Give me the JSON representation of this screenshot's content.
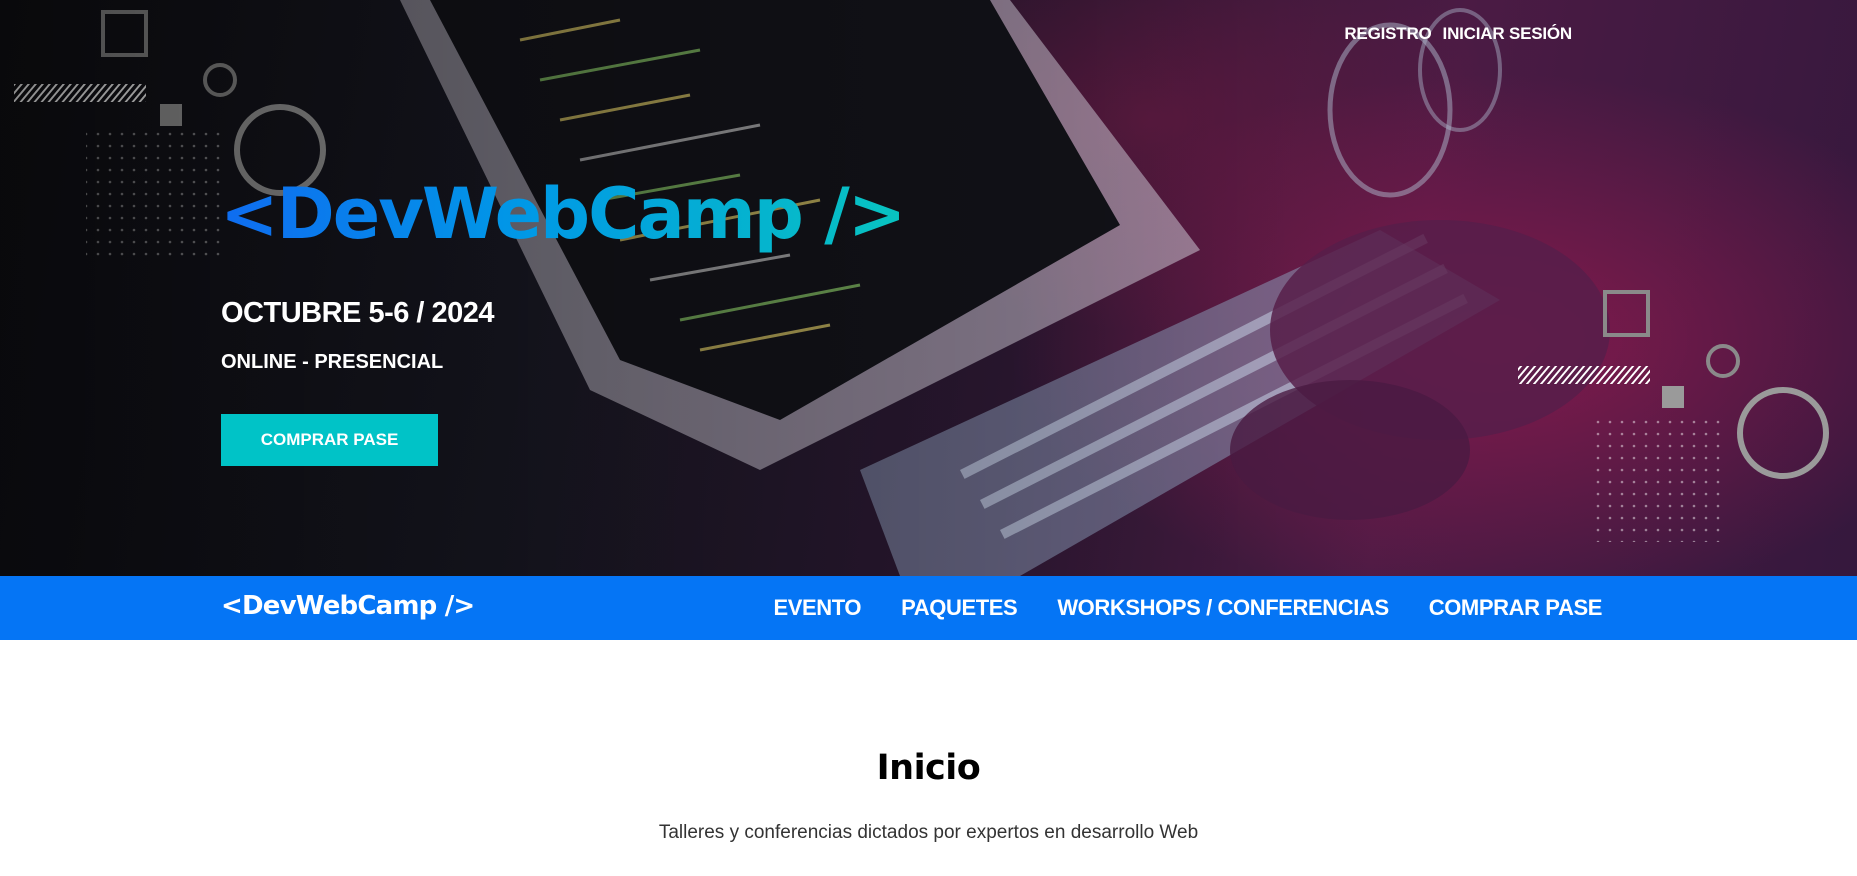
{
  "header": {
    "links": [
      {
        "label": "REGISTRO"
      },
      {
        "label": "INICIAR SESIÓN"
      }
    ]
  },
  "hero": {
    "brand": "<DevWebCamp />",
    "date": "OCTUBRE 5-6 / 2024",
    "mode": "ONLINE - PRESENCIAL",
    "cta_label": "COMPRAR PASE",
    "brand_gradient": [
      "#0f6cf0",
      "#08c4c0"
    ]
  },
  "navbar": {
    "logo": "<DevWebCamp />",
    "links": [
      {
        "label": "EVENTO"
      },
      {
        "label": "PAQUETES"
      },
      {
        "label": "WORKSHOPS / CONFERENCIAS"
      },
      {
        "label": "COMPRAR PASE"
      }
    ],
    "background": "#0575f5"
  },
  "section": {
    "title": "Inicio",
    "description": "Talleres y conferencias dictados por expertos en desarrollo Web"
  },
  "colors": {
    "accent": "#00c3c7",
    "primary": "#0575f5"
  }
}
